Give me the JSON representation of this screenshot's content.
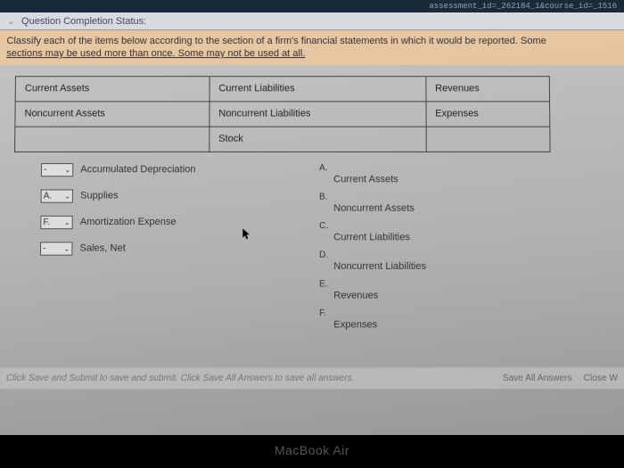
{
  "url_fragment": "assessment_id=_262184_1&course_id=_1516",
  "status": {
    "label": "Question Completion Status:"
  },
  "instruction": {
    "line1": "Classify each of the items below according to the section of a firm's financial statements in which it would be reported. Some",
    "line2": "sections may be used more than once.  Some may not be used at all."
  },
  "categories": {
    "r0c0": "Current Assets",
    "r0c1": "Current Liabilities",
    "r0c2": "Revenues",
    "r1c0": "Noncurrent Assets",
    "r1c1": "Noncurrent Liabilities",
    "r1c2": "Expenses",
    "r2c0": "",
    "r2c1": "Stock",
    "r2c2": ""
  },
  "matching_items": [
    {
      "value": "-",
      "label": "Accumulated Depreciation"
    },
    {
      "value": "A.",
      "label": "Supplies"
    },
    {
      "value": "F.",
      "label": "Amortization Expense"
    },
    {
      "value": "-",
      "label": "Sales, Net"
    }
  ],
  "answer_key": [
    {
      "letter": "A.",
      "label": "Current Assets"
    },
    {
      "letter": "B.",
      "label": "Noncurrent Assets"
    },
    {
      "letter": "C.",
      "label": "Current Liabilities"
    },
    {
      "letter": "D.",
      "label": "Noncurrent Liabilities"
    },
    {
      "letter": "E.",
      "label": "Revenues"
    },
    {
      "letter": "F.",
      "label": "Expenses"
    }
  ],
  "footer": {
    "hint": "Click Save and Submit to save and submit. Click Save All Answers to save all answers.",
    "save_all": "Save All Answers",
    "close": "Close W"
  },
  "laptop": "MacBook Air"
}
